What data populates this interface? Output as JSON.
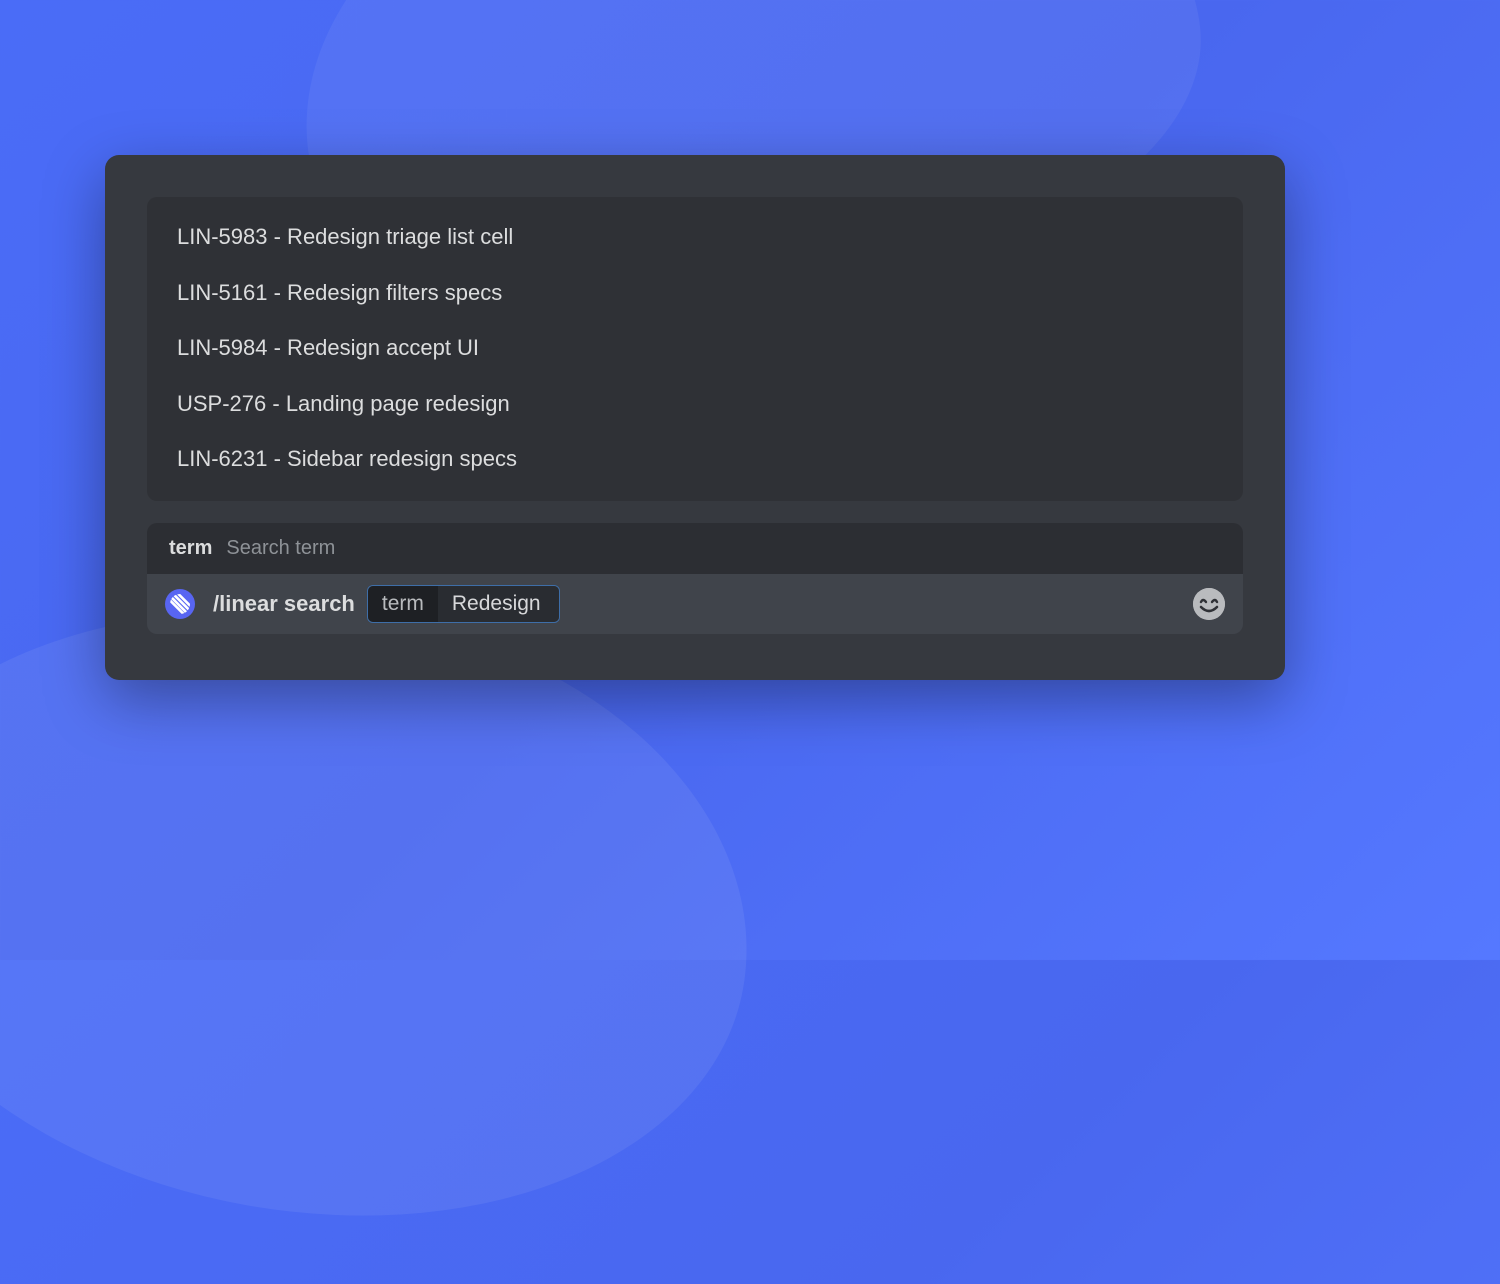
{
  "results": [
    {
      "label": "LIN-5983 - Redesign triage list cell"
    },
    {
      "label": "LIN-5161 - Redesign filters specs"
    },
    {
      "label": "LIN-5984 - Redesign accept UI"
    },
    {
      "label": "USP-276 - Landing page redesign"
    },
    {
      "label": "LIN-6231 - Sidebar redesign specs"
    }
  ],
  "param": {
    "name": "term",
    "description": "Search term"
  },
  "command": {
    "text": "/linear search",
    "pill_key": "term",
    "pill_value": "Redesign"
  },
  "icons": {
    "app": "linear-icon",
    "emoji": "emoji-picker-icon"
  },
  "colors": {
    "accent": "#5865f2",
    "window_bg": "#36393f",
    "panel_bg": "#2f3136",
    "input_bg": "#40444b"
  }
}
